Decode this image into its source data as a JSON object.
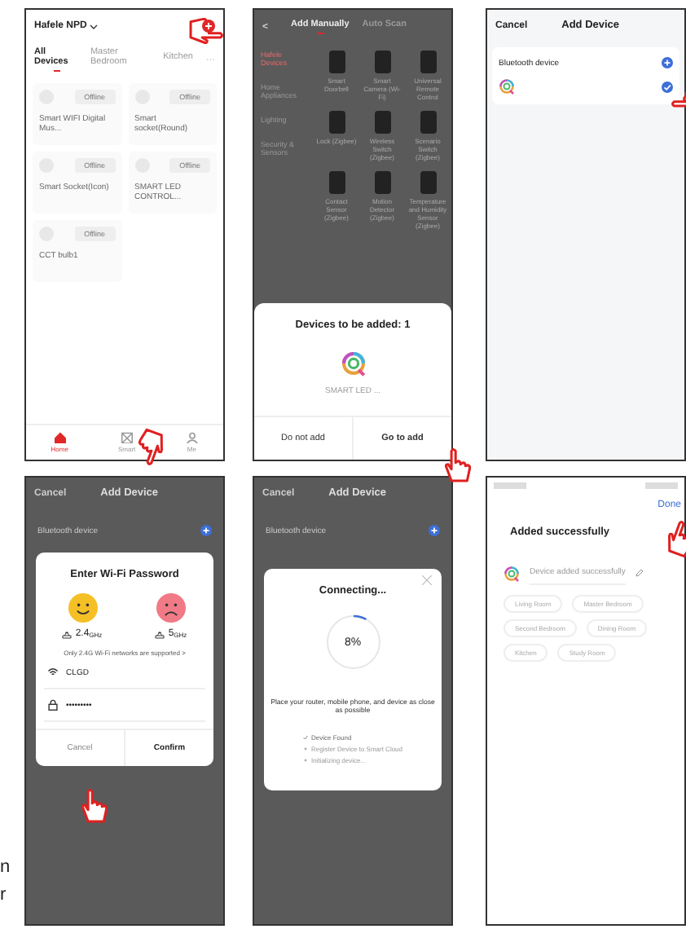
{
  "screens": [
    {
      "kind": "home",
      "title": "Hafele NPD",
      "tabs": [
        {
          "label": "All Devices",
          "selected": true
        },
        {
          "label": "Master Bedroom",
          "selected": false
        },
        {
          "label": "Kitchen",
          "selected": false
        }
      ],
      "more": "···",
      "devices": [
        {
          "name": "Smart WIFI Digital Mus...",
          "status": "Offline"
        },
        {
          "name": "Smart socket(Round)",
          "status": "Offline"
        },
        {
          "name": "Smart Socket(Icon)",
          "status": "Offline"
        },
        {
          "name": "SMART LED CONTROL...",
          "status": "Offline"
        },
        {
          "name": "CCT bulb1",
          "status": "Offline"
        }
      ],
      "nav": [
        {
          "label": "Home",
          "selected": true
        },
        {
          "label": "Smart",
          "selected": false
        },
        {
          "label": "Me",
          "selected": false
        }
      ]
    },
    {
      "kind": "add_manually",
      "back": "<",
      "tabs": [
        {
          "label": "Add Manually",
          "selected": true
        },
        {
          "label": "Auto Scan",
          "selected": false
        }
      ],
      "categories": [
        {
          "label": "Hafele Devices",
          "selected": true
        },
        {
          "label": "Home Appliances",
          "selected": false
        },
        {
          "label": "Lighting",
          "selected": false
        },
        {
          "label": "Security & Sensors",
          "selected": false
        }
      ],
      "products": [
        "Smart Doorbell",
        "Smart Camera (Wi-Fi)",
        "Universal Remote Control",
        "Lock (Zigbee)",
        "Wireless Switch (Zigbee)",
        "Scenario Switch (Zigbee)",
        "Contact Sensor (Zigbee)",
        "Motion Detector (Zigbee)",
        "Temperature and Humidity Sensor (Zigbee)"
      ],
      "dialog": {
        "title": "Devices to be added: 1",
        "device": "SMART LED ...",
        "buttons": [
          "Do not add",
          "Go to add"
        ]
      }
    },
    {
      "kind": "add_device",
      "cancel": "Cancel",
      "title": "Add Device",
      "section": "Bluetooth device",
      "item": {
        "checked": true
      }
    },
    {
      "kind": "wifi",
      "cancel": "Cancel",
      "title": "Add Device",
      "section": "Bluetooth device",
      "dialog": {
        "title": "Enter Wi-Fi Password",
        "bands": [
          {
            "value": "2.4",
            "unit": "GHz",
            "supported": true
          },
          {
            "value": "5",
            "unit": "GHz",
            "supported": false
          }
        ],
        "note": "Only 2.4G Wi-Fi networks are supported >",
        "ssid": "CLGD",
        "password": "•••••••••",
        "buttons": [
          "Cancel",
          "Confirm"
        ]
      }
    },
    {
      "kind": "connecting",
      "cancel": "Cancel",
      "title": "Add Device",
      "section": "Bluetooth device",
      "dialog": {
        "title": "Connecting...",
        "level": 0.08,
        "reading": "8%",
        "note": "Place your router, mobile phone, and device as close as possible",
        "steps": [
          {
            "label": "Device Found",
            "done": true
          },
          {
            "label": "Register Device to Smart Cloud",
            "done": false
          },
          {
            "label": "Initializing device...",
            "done": false
          }
        ]
      }
    },
    {
      "kind": "success",
      "done": "Done",
      "title": "Added successfully",
      "device": "Device added successfully",
      "rooms": [
        "Living Room",
        "Master Bedroom",
        "Second Bedroom",
        "Dining Room",
        "Kitchen",
        "Study Room"
      ]
    }
  ],
  "margin_text": [
    "n",
    "r"
  ]
}
